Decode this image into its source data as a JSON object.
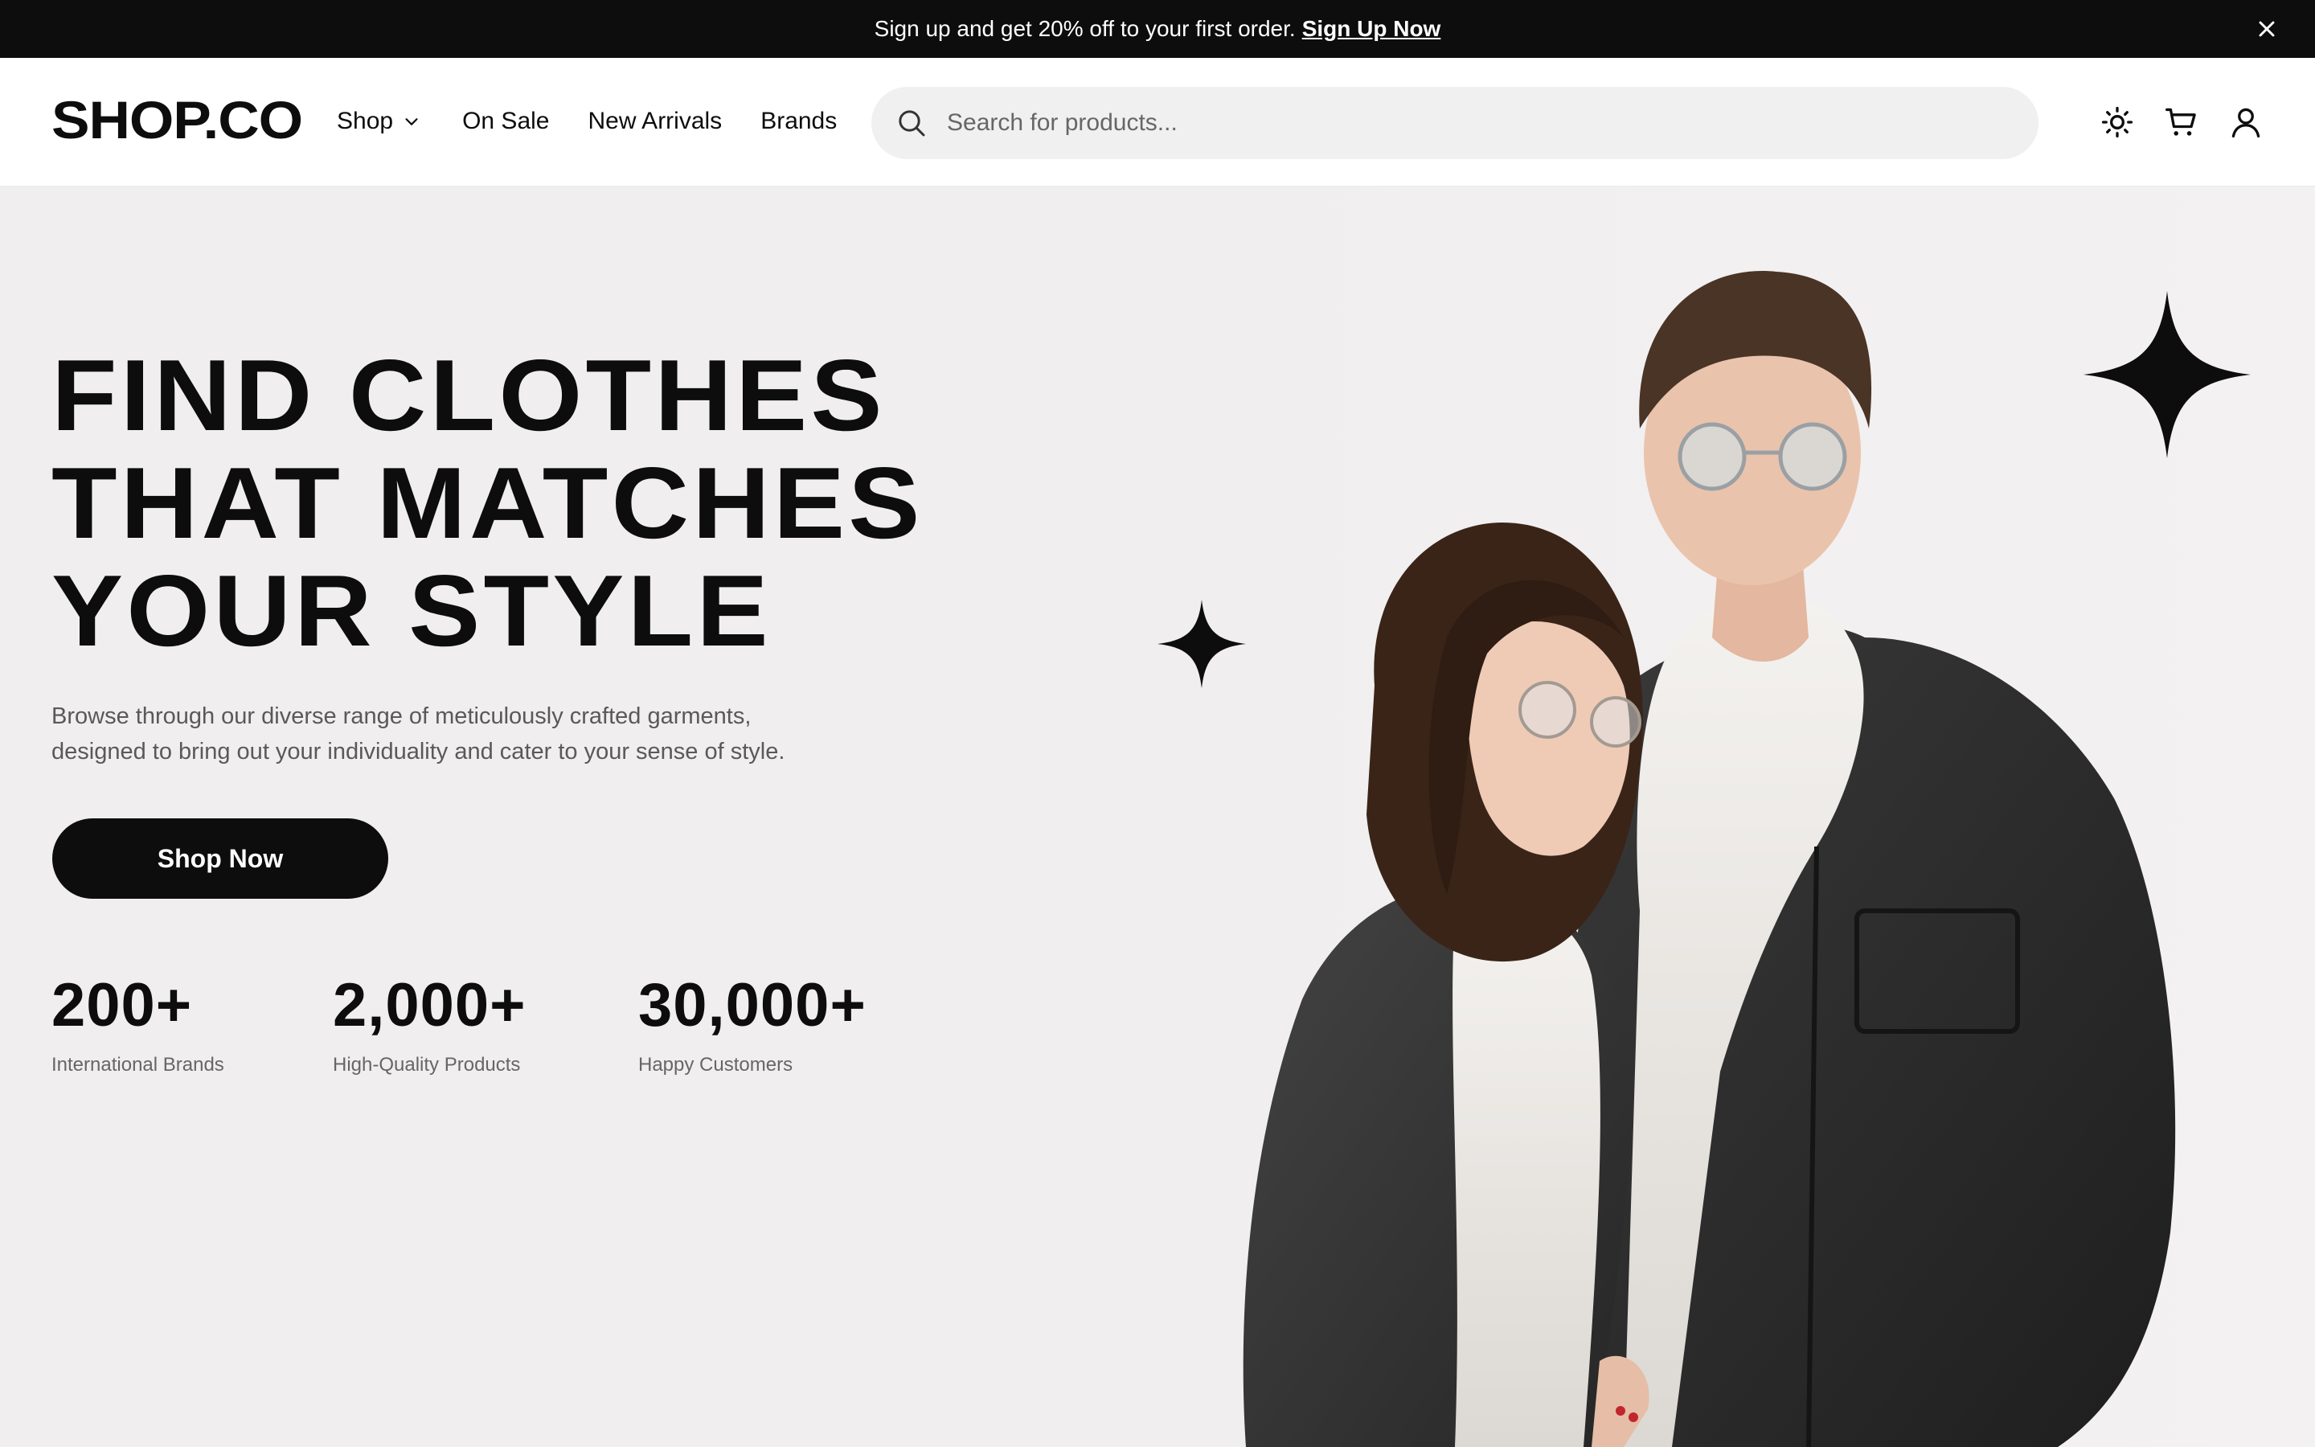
{
  "promo": {
    "text": "Sign up and get 20% off to your first order.",
    "link_label": "Sign Up Now",
    "close_icon": "close-icon"
  },
  "header": {
    "logo": "SHOP.CO",
    "nav": [
      {
        "label": "Shop",
        "has_dropdown": true
      },
      {
        "label": "On Sale"
      },
      {
        "label": "New Arrivals"
      },
      {
        "label": "Brands"
      }
    ],
    "search": {
      "placeholder": "Search for products...",
      "value": "",
      "icon": "search-icon"
    },
    "icons": [
      "sun-icon",
      "cart-icon",
      "user-icon"
    ]
  },
  "hero": {
    "headline": [
      "FIND CLOTHES",
      "THAT MATCHES",
      "YOUR STYLE"
    ],
    "subtext_lines": [
      "Browse through our diverse range of meticulously crafted garments,",
      "designed to bring out your individuality and cater to your sense of style."
    ],
    "cta_label": "Shop Now",
    "stats": [
      {
        "value": "200+",
        "label": "International Brands"
      },
      {
        "value": "2,000+",
        "label": "High-Quality Products"
      },
      {
        "value": "30,000+",
        "label": "Happy Customers"
      }
    ]
  },
  "colors": {
    "primary": "#0d0d0d",
    "hero_background": "#f0eeee",
    "search_background": "#f0f0f0",
    "muted_text": "#595959"
  }
}
